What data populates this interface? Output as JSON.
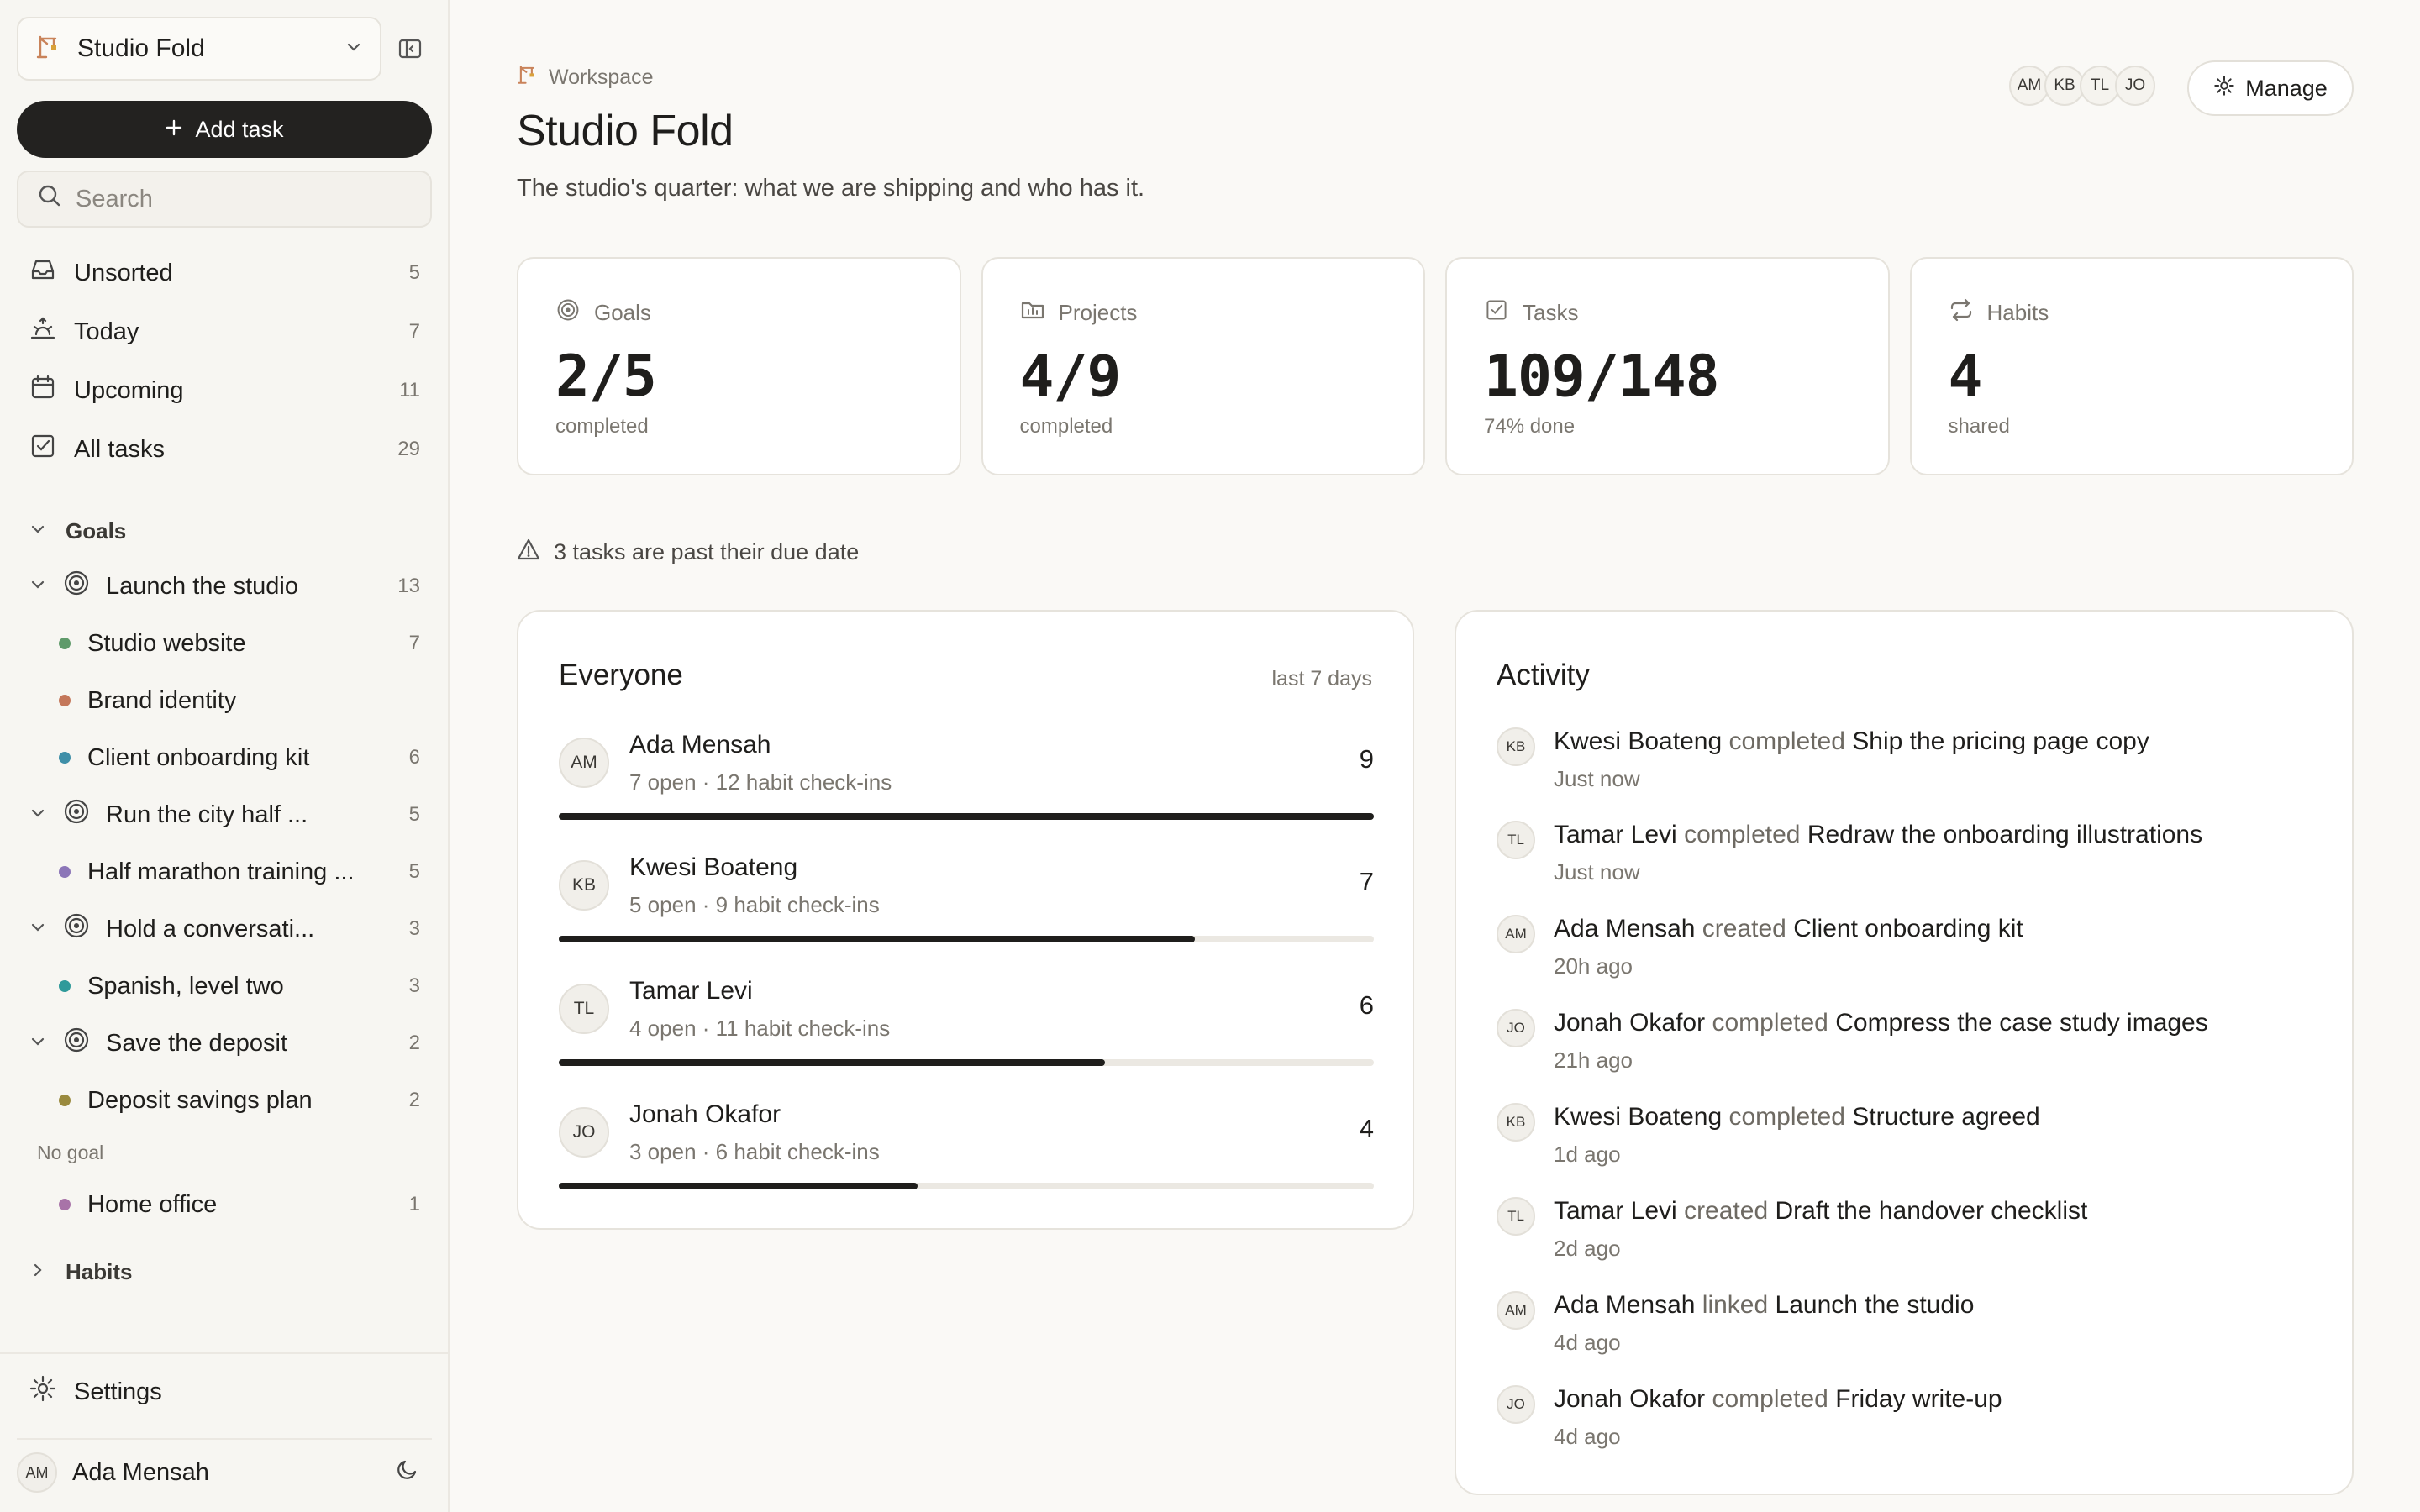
{
  "workspace": {
    "name": "Studio Fold"
  },
  "sidebar": {
    "add_task_label": "Add task",
    "search_placeholder": "Search",
    "nav": [
      {
        "label": "Unsorted",
        "count": "5",
        "icon": "inbox-icon"
      },
      {
        "label": "Today",
        "count": "7",
        "icon": "sunrise-icon"
      },
      {
        "label": "Upcoming",
        "count": "11",
        "icon": "calendar-icon"
      },
      {
        "label": "All tasks",
        "count": "29",
        "icon": "checkbox-icon"
      }
    ],
    "goals_label": "Goals",
    "goals": [
      {
        "label": "Launch the studio",
        "count": "13",
        "projects": [
          {
            "label": "Studio website",
            "count": "7",
            "color": "#5f9a6a"
          },
          {
            "label": "Brand identity",
            "count": "",
            "color": "#c4775a"
          },
          {
            "label": "Client onboarding kit",
            "count": "6",
            "color": "#3f8fa8"
          }
        ]
      },
      {
        "label": "Run the city half ...",
        "count": "5",
        "projects": [
          {
            "label": "Half marathon training ...",
            "count": "5",
            "color": "#8c76b8"
          }
        ]
      },
      {
        "label": "Hold a conversati...",
        "count": "3",
        "projects": [
          {
            "label": "Spanish, level two",
            "count": "3",
            "color": "#2f9a9a"
          }
        ]
      },
      {
        "label": "Save the deposit",
        "count": "2",
        "projects": [
          {
            "label": "Deposit savings plan",
            "count": "2",
            "color": "#9a8a3e"
          }
        ]
      }
    ],
    "no_goal_label": "No goal",
    "no_goal_projects": [
      {
        "label": "Home office",
        "count": "1",
        "color": "#a873a8"
      }
    ],
    "habits_label": "Habits",
    "settings_label": "Settings",
    "user": {
      "initials": "AM",
      "name": "Ada Mensah"
    }
  },
  "header": {
    "breadcrumb": "Workspace",
    "title": "Studio Fold",
    "subtitle": "The studio's quarter: what we are shipping and who has it.",
    "members": [
      "AM",
      "KB",
      "TL",
      "JO"
    ],
    "manage_label": "Manage"
  },
  "stats": [
    {
      "label": "Goals",
      "value": "2/5",
      "sub": "completed",
      "icon": "target-icon"
    },
    {
      "label": "Projects",
      "value": "4/9",
      "sub": "completed",
      "icon": "folder-icon"
    },
    {
      "label": "Tasks",
      "value": "109/148",
      "sub": "74% done",
      "icon": "checkbox-icon"
    },
    {
      "label": "Habits",
      "value": "4",
      "sub": "shared",
      "icon": "repeat-icon"
    }
  ],
  "warning": "3 tasks are past their due date",
  "everyone": {
    "title": "Everyone",
    "range": "last 7 days",
    "people": [
      {
        "initials": "AM",
        "name": "Ada Mensah",
        "meta": "7 open · 12 habit check-ins",
        "count": "9",
        "progress": 1.0
      },
      {
        "initials": "KB",
        "name": "Kwesi Boateng",
        "meta": "5 open · 9 habit check-ins",
        "count": "7",
        "progress": 0.78
      },
      {
        "initials": "TL",
        "name": "Tamar Levi",
        "meta": "4 open · 11 habit check-ins",
        "count": "6",
        "progress": 0.67
      },
      {
        "initials": "JO",
        "name": "Jonah Okafor",
        "meta": "3 open · 6 habit check-ins",
        "count": "4",
        "progress": 0.44
      }
    ]
  },
  "activity": {
    "title": "Activity",
    "items": [
      {
        "initials": "KB",
        "actor": "Kwesi Boateng",
        "verb": "completed",
        "object": "Ship the pricing page copy",
        "time": "Just now"
      },
      {
        "initials": "TL",
        "actor": "Tamar Levi",
        "verb": "completed",
        "object": "Redraw the onboarding illustrations",
        "time": "Just now"
      },
      {
        "initials": "AM",
        "actor": "Ada Mensah",
        "verb": "created",
        "object": "Client onboarding kit",
        "time": "20h ago"
      },
      {
        "initials": "JO",
        "actor": "Jonah Okafor",
        "verb": "completed",
        "object": "Compress the case study images",
        "time": "21h ago"
      },
      {
        "initials": "KB",
        "actor": "Kwesi Boateng",
        "verb": "completed",
        "object": "Structure agreed",
        "time": "1d ago"
      },
      {
        "initials": "TL",
        "actor": "Tamar Levi",
        "verb": "created",
        "object": "Draft the handover checklist",
        "time": "2d ago"
      },
      {
        "initials": "AM",
        "actor": "Ada Mensah",
        "verb": "linked",
        "object": "Launch the studio",
        "time": "4d ago"
      },
      {
        "initials": "JO",
        "actor": "Jonah Okafor",
        "verb": "completed",
        "object": "Friday write-up",
        "time": "4d ago"
      }
    ]
  }
}
